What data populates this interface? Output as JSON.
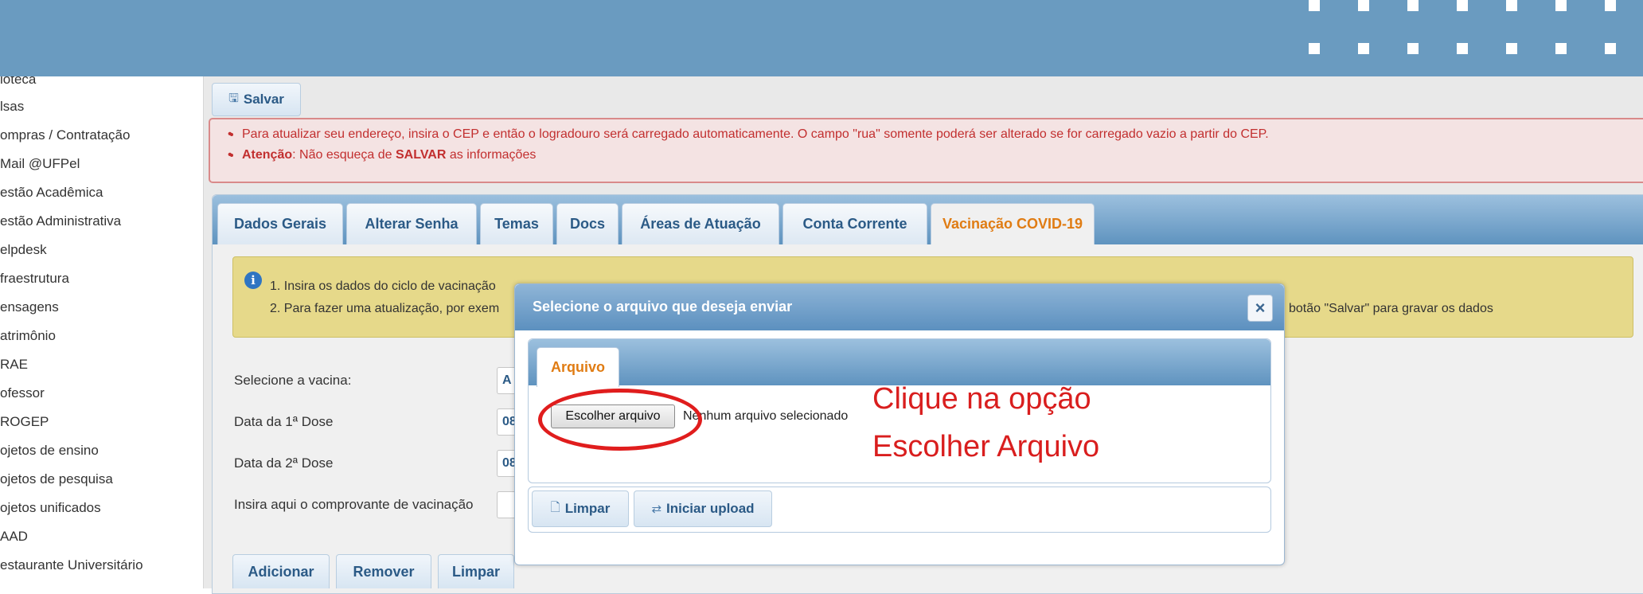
{
  "sidebar": {
    "items": [
      {
        "label": "ioteca"
      },
      {
        "label": "lsas"
      },
      {
        "label": "ompras / Contratação"
      },
      {
        "label": "Mail @UFPel"
      },
      {
        "label": "estão Acadêmica"
      },
      {
        "label": "estão Administrativa"
      },
      {
        "label": "elpdesk"
      },
      {
        "label": "fraestrutura"
      },
      {
        "label": "ensagens"
      },
      {
        "label": "atrimônio"
      },
      {
        "label": "RAE"
      },
      {
        "label": "ofessor"
      },
      {
        "label": "ROGEP"
      },
      {
        "label": "ojetos de ensino"
      },
      {
        "label": "ojetos de pesquisa"
      },
      {
        "label": "ojetos unificados"
      },
      {
        "label": "AAD"
      },
      {
        "label": "estaurante Universitário"
      }
    ]
  },
  "toolbar": {
    "save_label": "Salvar",
    "save_icon": "save-icon"
  },
  "alert": {
    "line1": "Para atualizar seu endereço, insira o CEP e então o logradouro será carregado automaticamente. O campo \"rua\" somente poderá ser alterado se for carregado vazio a partir do CEP.",
    "line2_bold1": "Atenção",
    "line2_text1": ": Não esqueça de ",
    "line2_bold2": "SALVAR",
    "line2_text2": " as informações"
  },
  "tabs": [
    {
      "label": "Dados Gerais"
    },
    {
      "label": "Alterar Senha"
    },
    {
      "label": "Temas"
    },
    {
      "label": "Docs"
    },
    {
      "label": "Áreas de Atuação"
    },
    {
      "label": "Conta Corrente"
    },
    {
      "label": "Vacinação COVID-19",
      "active": true
    }
  ],
  "info": {
    "line1": "1. Insira os dados do ciclo de vacinação",
    "line2_left": "2. Para fazer uma atualização, por exem",
    "line2_right": "botão \"Salvar\" para gravar os dados"
  },
  "form": {
    "vaccine_label": "Selecione a vacina:",
    "vaccine_value": "A",
    "dose1_label": "Data da 1ª Dose",
    "dose1_value": "08",
    "dose2_label": "Data da 2ª Dose",
    "dose2_value": "08",
    "proof_label": "Insira aqui o comprovante de vacinação"
  },
  "modal": {
    "title": "Selecione o arquivo que deseja enviar",
    "close_glyph": "×",
    "tab_label": "Arquivo",
    "choose_file_label": "Escolher arquivo",
    "file_status": "Nenhum arquivo selecionado",
    "clear_label": "Limpar",
    "upload_label": "Iniciar upload"
  },
  "annotation": {
    "line1": "Clique na opção",
    "line2": "Escolher Arquivo",
    "color": "#d91e1e"
  },
  "actions": {
    "add_label": "Adicionar",
    "remove_label": "Remover",
    "clear_label": "Limpar"
  }
}
